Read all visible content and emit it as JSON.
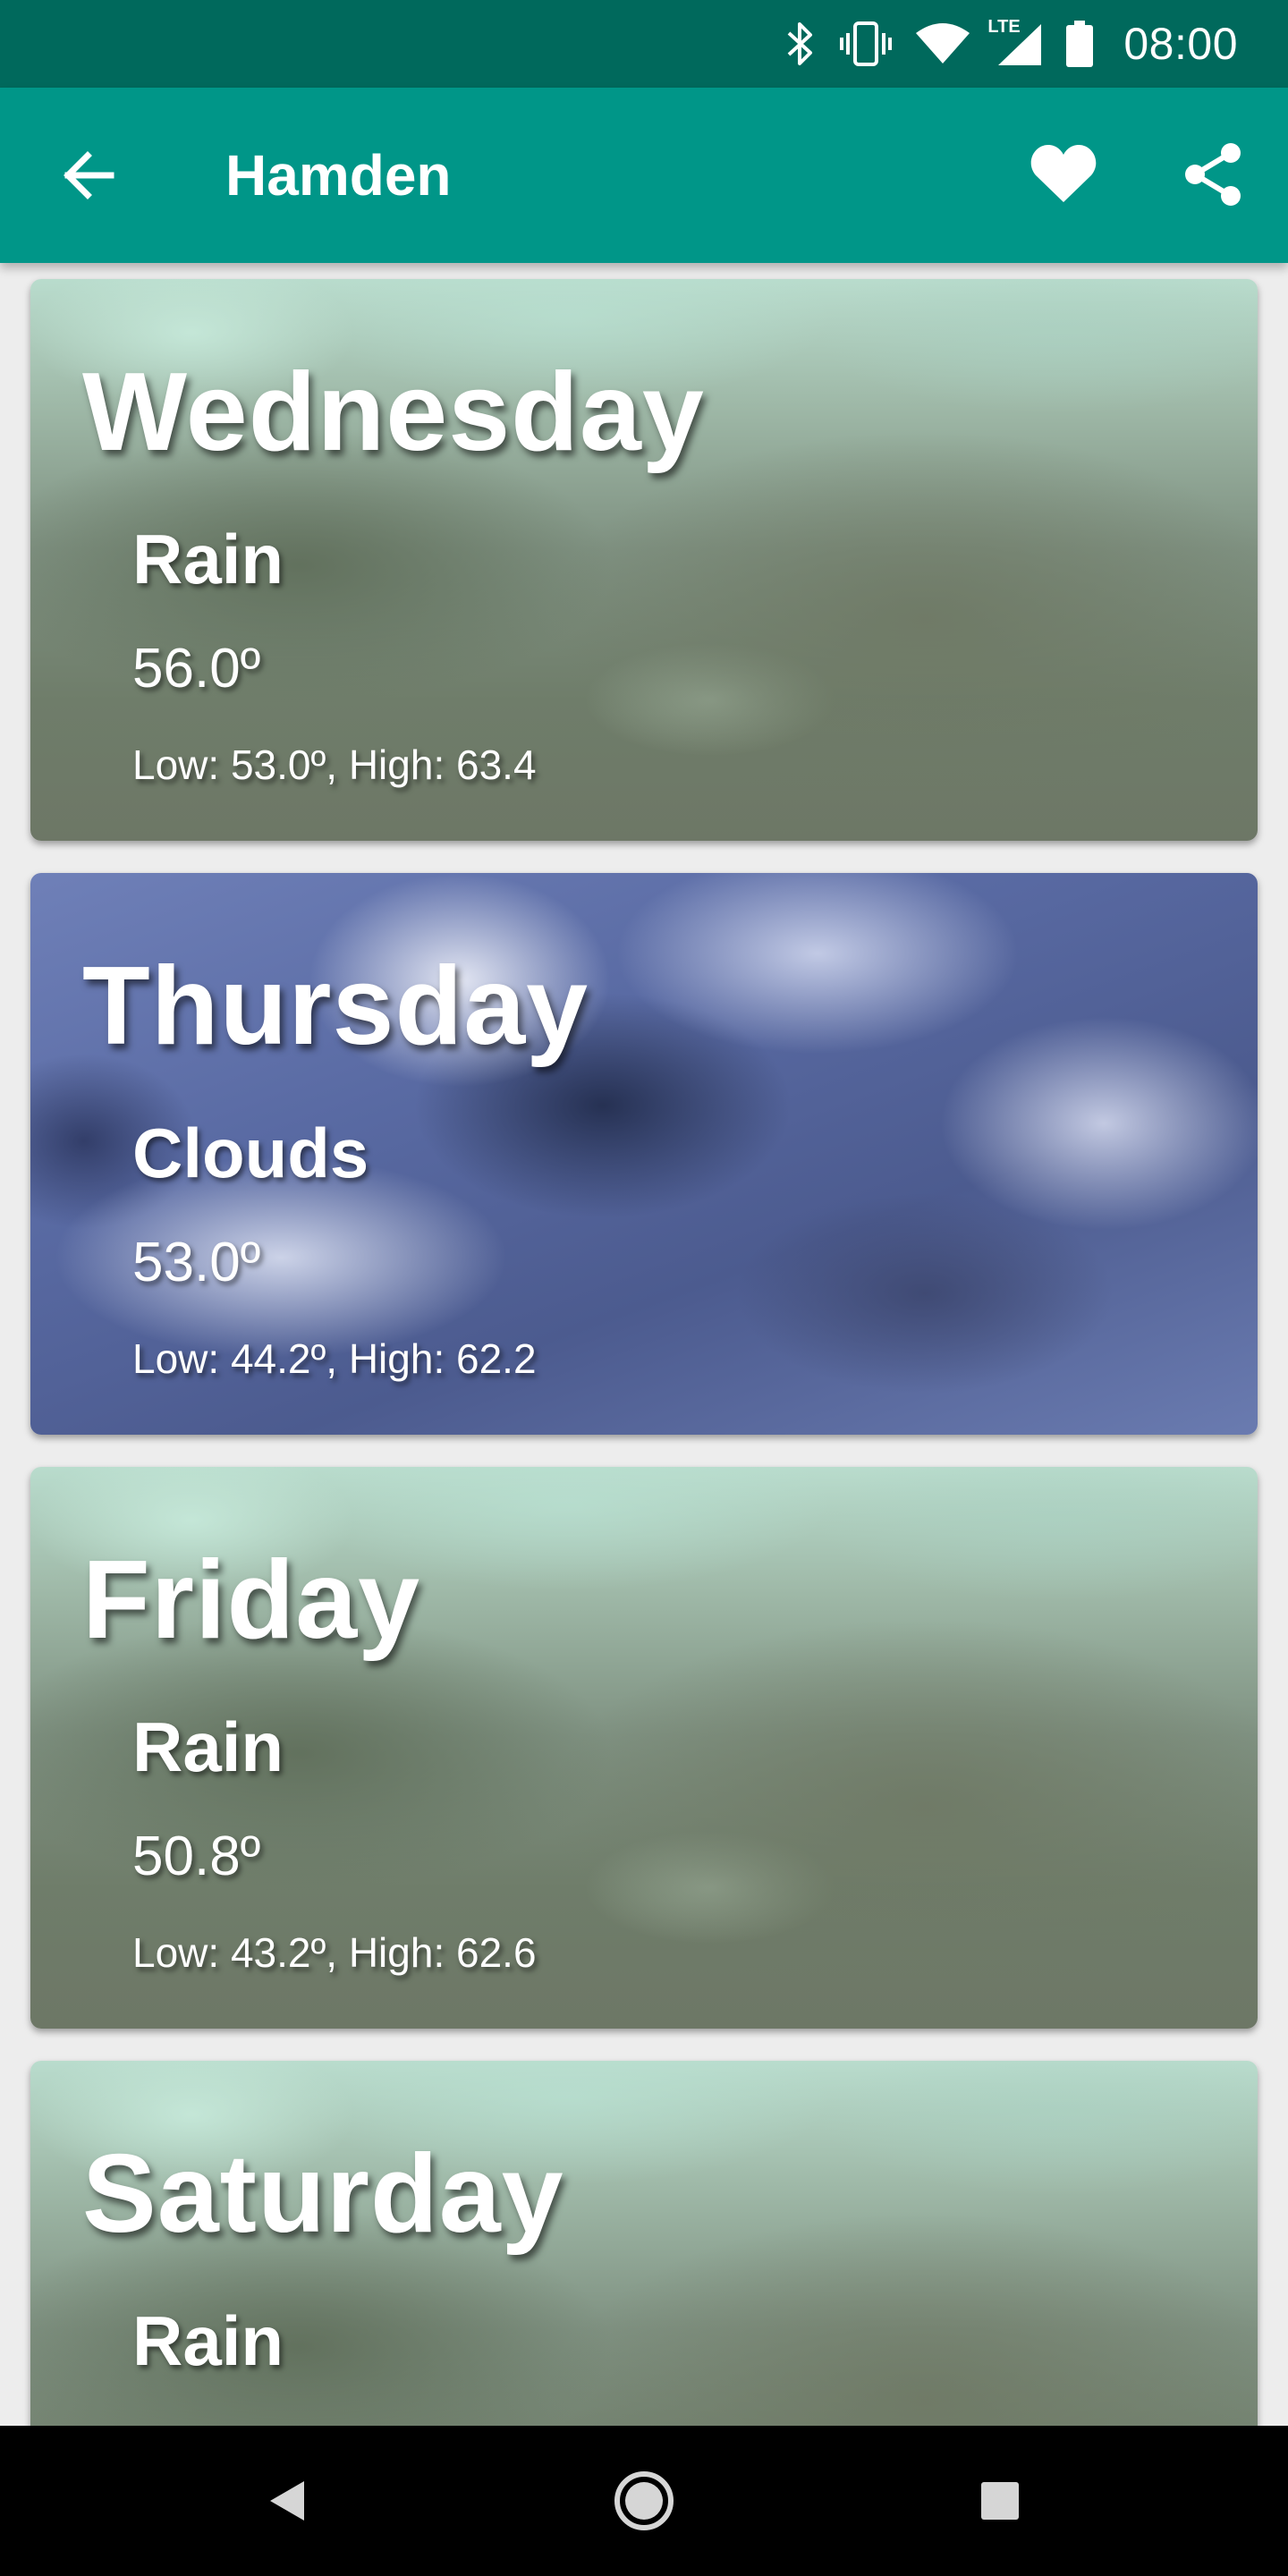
{
  "status_bar": {
    "time": "08:00",
    "icons": [
      "bluetooth-icon",
      "vibrate-icon",
      "wifi-icon",
      "lte-signal-icon",
      "battery-icon"
    ],
    "network_label": "LTE"
  },
  "app_bar": {
    "title": "Hamden",
    "back_icon": "arrow-back-icon",
    "favorite_icon": "heart-icon",
    "share_icon": "share-icon"
  },
  "forecast": [
    {
      "day": "Wednesday",
      "condition": "Rain",
      "temp": "56.0º",
      "range": "Low: 53.0º, High: 63.4",
      "background": "rain"
    },
    {
      "day": "Thursday",
      "condition": "Clouds",
      "temp": "53.0º",
      "range": "Low: 44.2º, High: 62.2",
      "background": "clouds"
    },
    {
      "day": "Friday",
      "condition": "Rain",
      "temp": "50.8º",
      "range": "Low: 43.2º, High: 62.6",
      "background": "rain"
    },
    {
      "day": "Saturday",
      "condition": "Rain",
      "temp": "",
      "range": "",
      "background": "rain"
    }
  ],
  "nav_bar": {
    "buttons": [
      "back-triangle-icon",
      "home-circle-icon",
      "recents-square-icon"
    ]
  },
  "colors": {
    "status_bar": "#00695c",
    "app_bar": "#009688",
    "nav_bar": "#000000",
    "text_on_primary": "#ffffff"
  }
}
